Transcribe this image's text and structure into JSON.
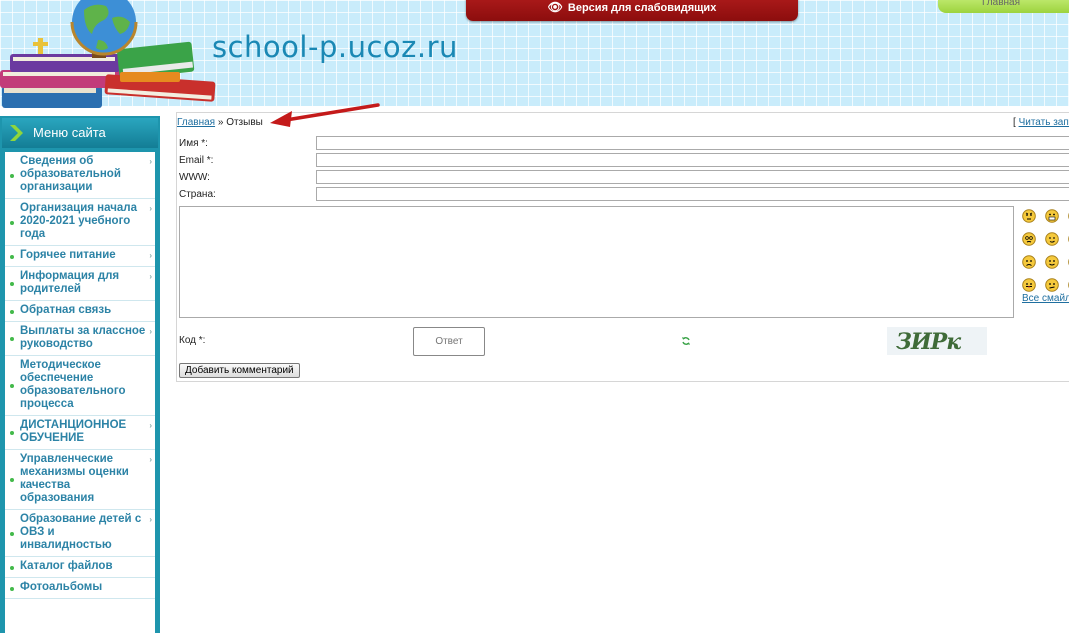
{
  "header": {
    "site_title": "school-p.ucoz.ru",
    "blind_version_label": "Версия для слабовидящих",
    "top_home_label": "Главная"
  },
  "sidebar": {
    "title": "Меню сайта",
    "items": [
      {
        "label": "Сведения об образовательной организации",
        "has_submenu": true
      },
      {
        "label": "Организация начала 2020-2021 учебного года",
        "has_submenu": true
      },
      {
        "label": "Горячее питание",
        "has_submenu": true
      },
      {
        "label": "Информация для родителей",
        "has_submenu": true
      },
      {
        "label": "Обратная связь",
        "has_submenu": false
      },
      {
        "label": "Выплаты за классное руководство",
        "has_submenu": true
      },
      {
        "label": "Методическое обеспечение образовательного процесса",
        "has_submenu": false
      },
      {
        "label": "ДИСТАНЦИОННОЕ ОБУЧЕНИЕ",
        "has_submenu": true
      },
      {
        "label": "Управленческие механизмы оценки качества образования",
        "has_submenu": true
      },
      {
        "label": "Образование детей с ОВЗ и инвалидностью",
        "has_submenu": true
      },
      {
        "label": "Каталог файлов",
        "has_submenu": false
      },
      {
        "label": "Фотоальбомы",
        "has_submenu": false
      }
    ]
  },
  "breadcrumb": {
    "home": "Главная",
    "separator": "»",
    "current": "Отзывы"
  },
  "read_entries_link": {
    "bracket": "[",
    "label": "Читать запи"
  },
  "form": {
    "name_label": "Имя *:",
    "email_label": "Email *:",
    "www_label": "WWW:",
    "country_label": "Страна:",
    "code_label": "Код *:",
    "answer_placeholder": "Ответ",
    "captcha_text": "ЗИРк",
    "submit_label": "Добавить комментарий",
    "all_smiles_label": "Все смайл"
  },
  "colors": {
    "sidebar_teal": "#1e95ad",
    "menu_link": "#2c83a6",
    "blind_button": "#a01414",
    "annotation_arrow": "#c41a1a",
    "header_bg": "#c9ecfb"
  }
}
